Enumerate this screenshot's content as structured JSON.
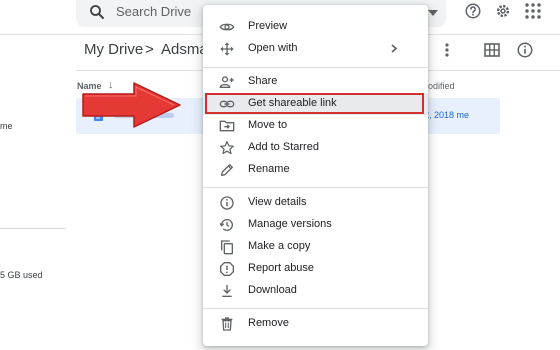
{
  "header": {
    "search_placeholder": "Search Drive",
    "icons": [
      "search-icon",
      "caret-down-icon",
      "help-icon",
      "settings-icon",
      "apps-grid-icon"
    ]
  },
  "left_nav": {
    "label_me": "me",
    "storage_used": "5 GB used"
  },
  "breadcrumb": {
    "root": "My Drive",
    "separator": ">",
    "folder": "Adsmas"
  },
  "toolbar": {
    "icons": [
      "more-vert-icon",
      "grid-view-icon",
      "info-icon"
    ]
  },
  "file_list": {
    "columns": {
      "name": "Name",
      "sort_arrow": "↓",
      "modified": "odified"
    },
    "rows": [
      {
        "date": "2, 2018 me",
        "selected": true
      }
    ]
  },
  "context_menu": {
    "groups": [
      [
        {
          "icon": "eye-icon",
          "label": "Preview"
        },
        {
          "icon": "open-with-icon",
          "label": "Open with",
          "submenu": true
        }
      ],
      [
        {
          "icon": "person-add-icon",
          "label": "Share"
        },
        {
          "icon": "link-icon",
          "label": "Get shareable link",
          "highlighted": true
        },
        {
          "icon": "move-to-icon",
          "label": "Move to"
        },
        {
          "icon": "star-icon",
          "label": "Add to Starred"
        },
        {
          "icon": "pencil-icon",
          "label": "Rename"
        }
      ],
      [
        {
          "icon": "info-icon",
          "label": "View details"
        },
        {
          "icon": "history-icon",
          "label": "Manage versions"
        },
        {
          "icon": "copy-icon",
          "label": "Make a copy"
        },
        {
          "icon": "report-icon",
          "label": "Report abuse"
        },
        {
          "icon": "download-icon",
          "label": "Download"
        }
      ],
      [
        {
          "icon": "trash-icon",
          "label": "Remove"
        }
      ]
    ]
  },
  "annotation": {
    "arrow_color": "#e53935",
    "box_color": "#d32f2f"
  },
  "colors": {
    "selection_bg": "#e8f0fe",
    "selection_text": "#1967d2",
    "hover_bg": "#e8eaed"
  }
}
